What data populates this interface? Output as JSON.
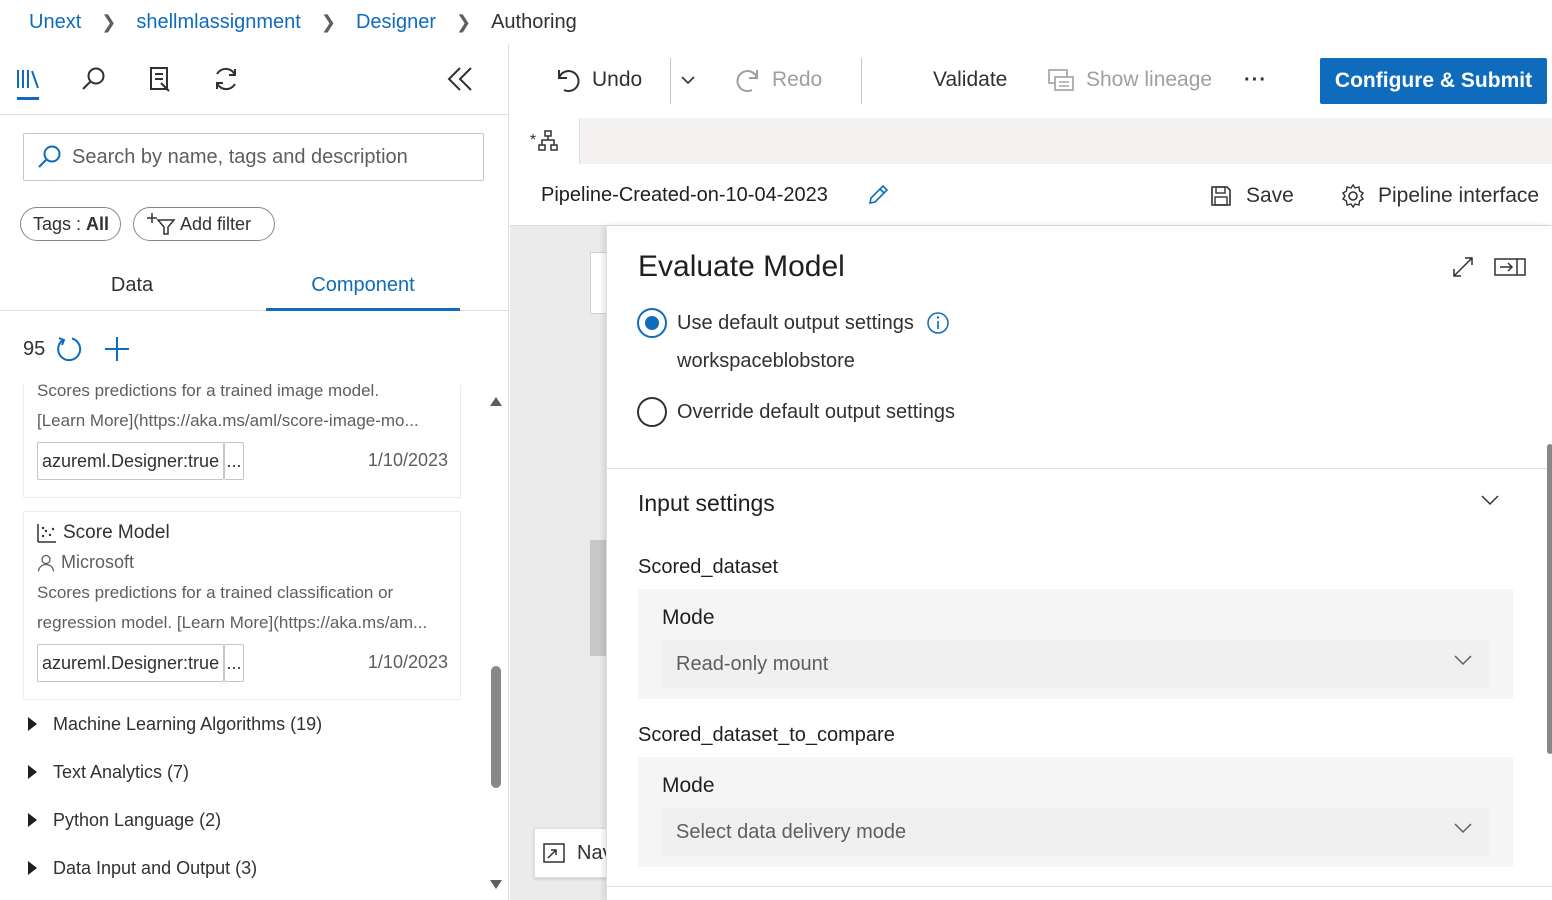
{
  "breadcrumb": {
    "items": [
      "Unext",
      "shellmlassignment",
      "Designer"
    ],
    "current": "Authoring"
  },
  "left_panel": {
    "icons": [
      "library-icon",
      "search-icon",
      "asset-icon",
      "refresh-icon"
    ],
    "search_placeholder": "Search by name, tags and description",
    "tags_filter": {
      "label": "Tags : ",
      "value": "All"
    },
    "add_filter_label": "Add filter",
    "tabs": {
      "data": "Data",
      "component": "Component"
    },
    "component_count": "95",
    "cards": [
      {
        "desc_line1": "Scores predictions for a trained image model.",
        "desc_line2": "[Learn More](https://aka.ms/aml/score-image-mo...",
        "tag": "azureml.Designer:true",
        "more": "...",
        "date": "1/10/2023"
      },
      {
        "title": "Score Model",
        "author": "Microsoft",
        "desc_line1": "Scores predictions for a trained classification or",
        "desc_line2": "regression model. [Learn More](https://aka.ms/am...",
        "tag": "azureml.Designer:true",
        "more": "...",
        "date": "1/10/2023"
      }
    ],
    "categories": [
      "Machine Learning Algorithms (19)",
      "Text Analytics (7)",
      "Python Language (2)",
      "Data Input and Output (3)"
    ]
  },
  "toolbar": {
    "undo": "Undo",
    "redo": "Redo",
    "validate": "Validate",
    "show_lineage": "Show lineage",
    "more": "···",
    "submit": "Configure & Submit"
  },
  "pipeline": {
    "tab_icon_prefix": "*",
    "title": "Pipeline-Created-on-10-04-2023",
    "save": "Save",
    "interface": "Pipeline interface"
  },
  "canvas": {
    "navigator_label": "Nav"
  },
  "right_panel": {
    "title": "Evaluate Model",
    "output": {
      "default_label": "Use default output settings",
      "datastore": "workspaceblobstore",
      "override_label": "Override default output settings",
      "selected": "default"
    },
    "input_settings": {
      "header": "Input settings",
      "fields": [
        {
          "name": "Scored_dataset",
          "mode_label": "Mode",
          "value": "Read-only mount"
        },
        {
          "name": "Scored_dataset_to_compare",
          "mode_label": "Mode",
          "value": "Select data delivery mode"
        }
      ]
    }
  },
  "colors": {
    "accent": "#0f6cbd",
    "text": "#323130",
    "muted": "#605e5c"
  }
}
